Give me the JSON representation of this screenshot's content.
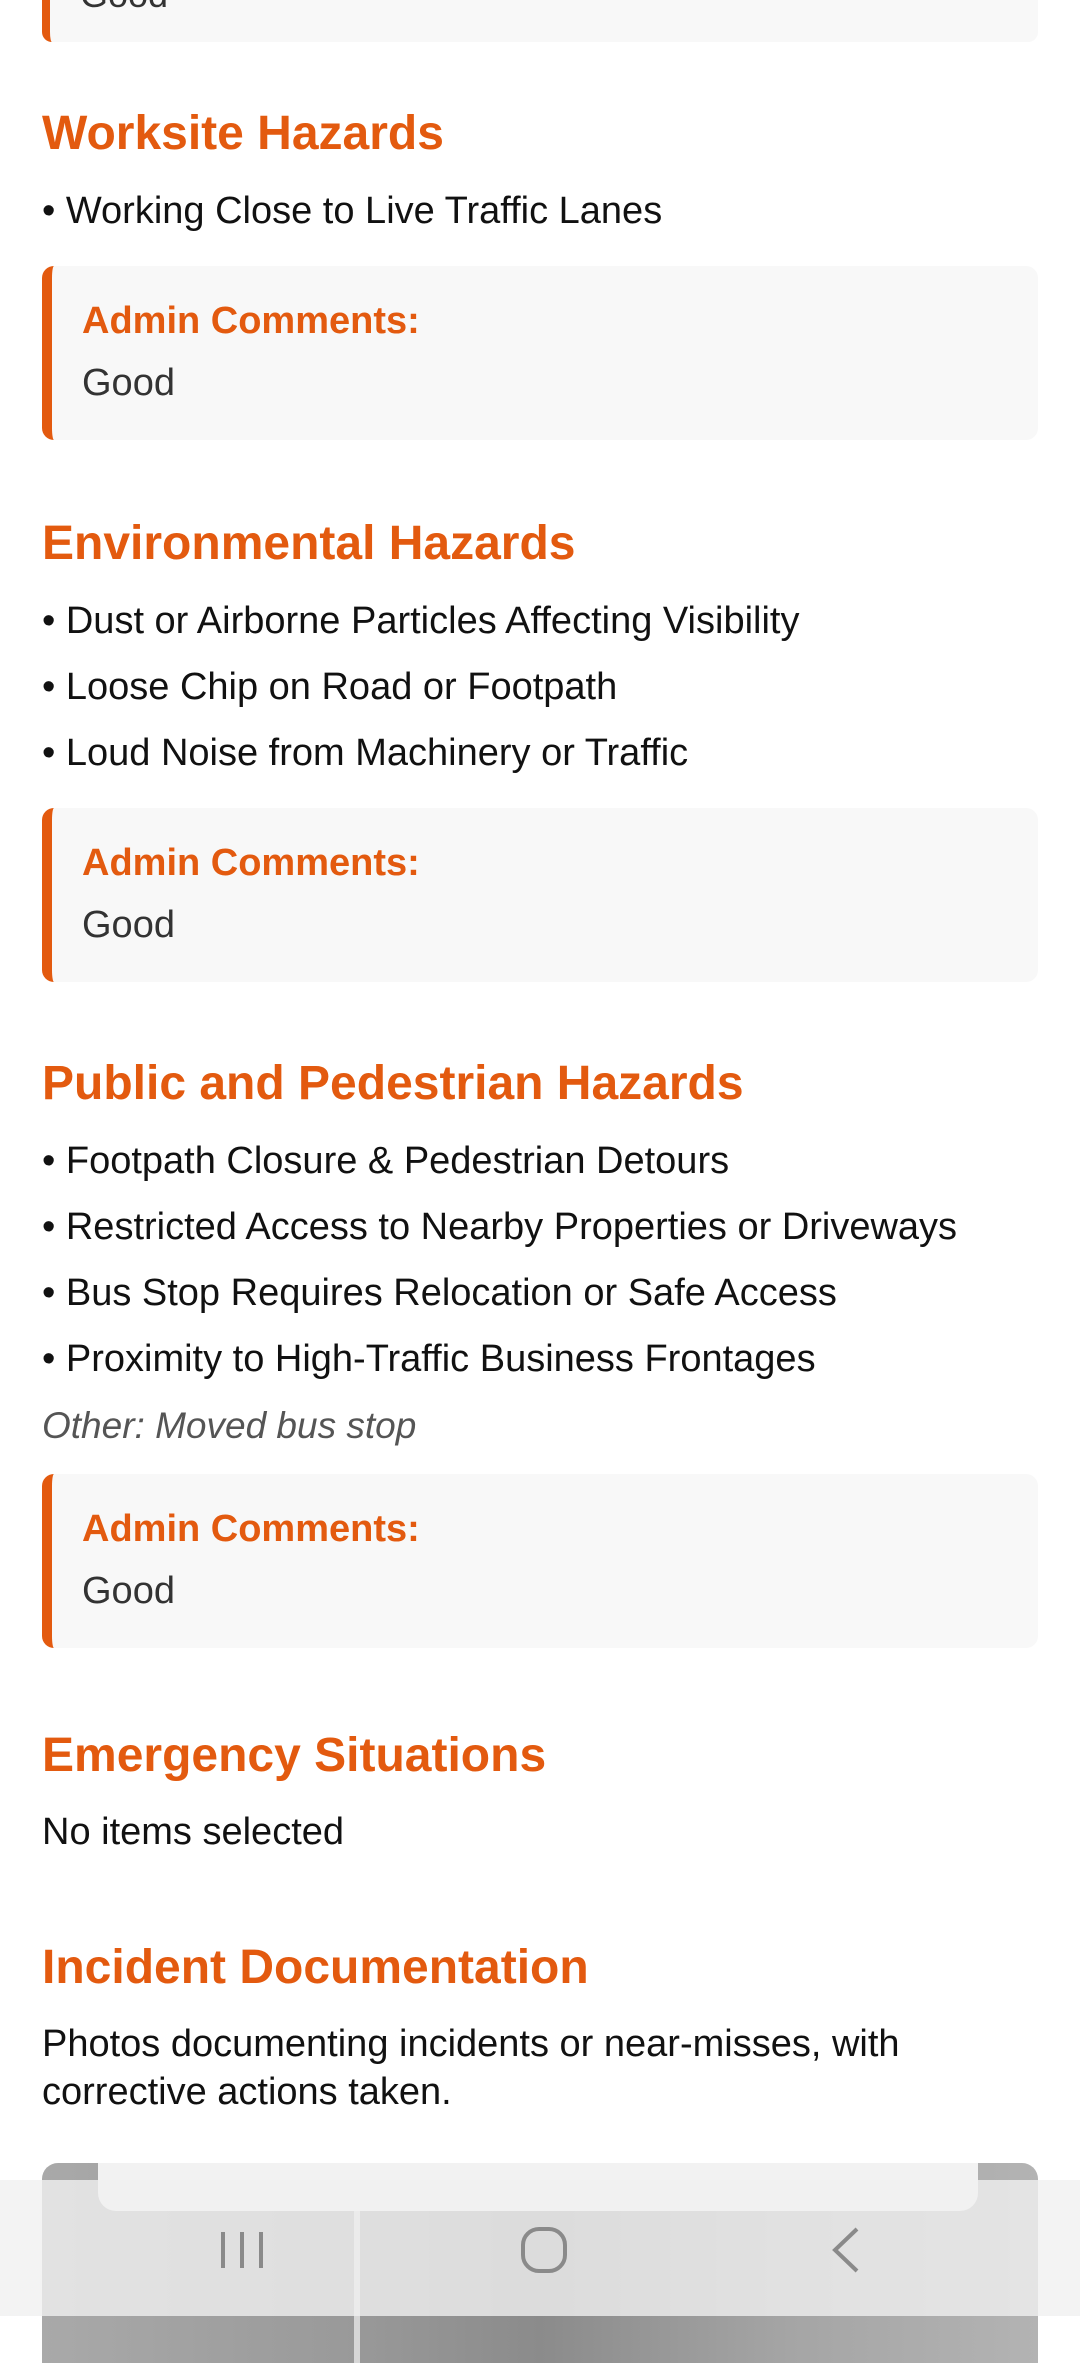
{
  "top_card": {
    "value": "Good"
  },
  "sections": {
    "worksite": {
      "title": "Worksite Hazards",
      "items": [
        "• Working Close to Live Traffic Lanes"
      ],
      "comment_label": "Admin Comments:",
      "comment_value": "Good"
    },
    "environmental": {
      "title": "Environmental Hazards",
      "items": [
        "• Dust or Airborne Particles Affecting Visibility",
        "• Loose Chip on Road or Footpath",
        "• Loud Noise from Machinery or Traffic"
      ],
      "comment_label": "Admin Comments:",
      "comment_value": "Good"
    },
    "public": {
      "title": "Public and Pedestrian Hazards",
      "items": [
        "• Footpath Closure & Pedestrian Detours",
        "• Restricted Access to Nearby Properties or Driveways",
        "• Bus Stop Requires Relocation or Safe Access",
        "• Proximity to High-Traffic Business Frontages"
      ],
      "other": "Other: Moved bus stop",
      "comment_label": "Admin Comments:",
      "comment_value": "Good"
    },
    "emergency": {
      "title": "Emergency Situations",
      "empty": "No items selected"
    },
    "incident": {
      "title": "Incident Documentation",
      "description": "Photos documenting incidents or near-misses, with corrective actions taken."
    }
  },
  "nav": {
    "recents": "|||",
    "home": "○",
    "back": "‹"
  },
  "accent_color": "#e35a0f"
}
